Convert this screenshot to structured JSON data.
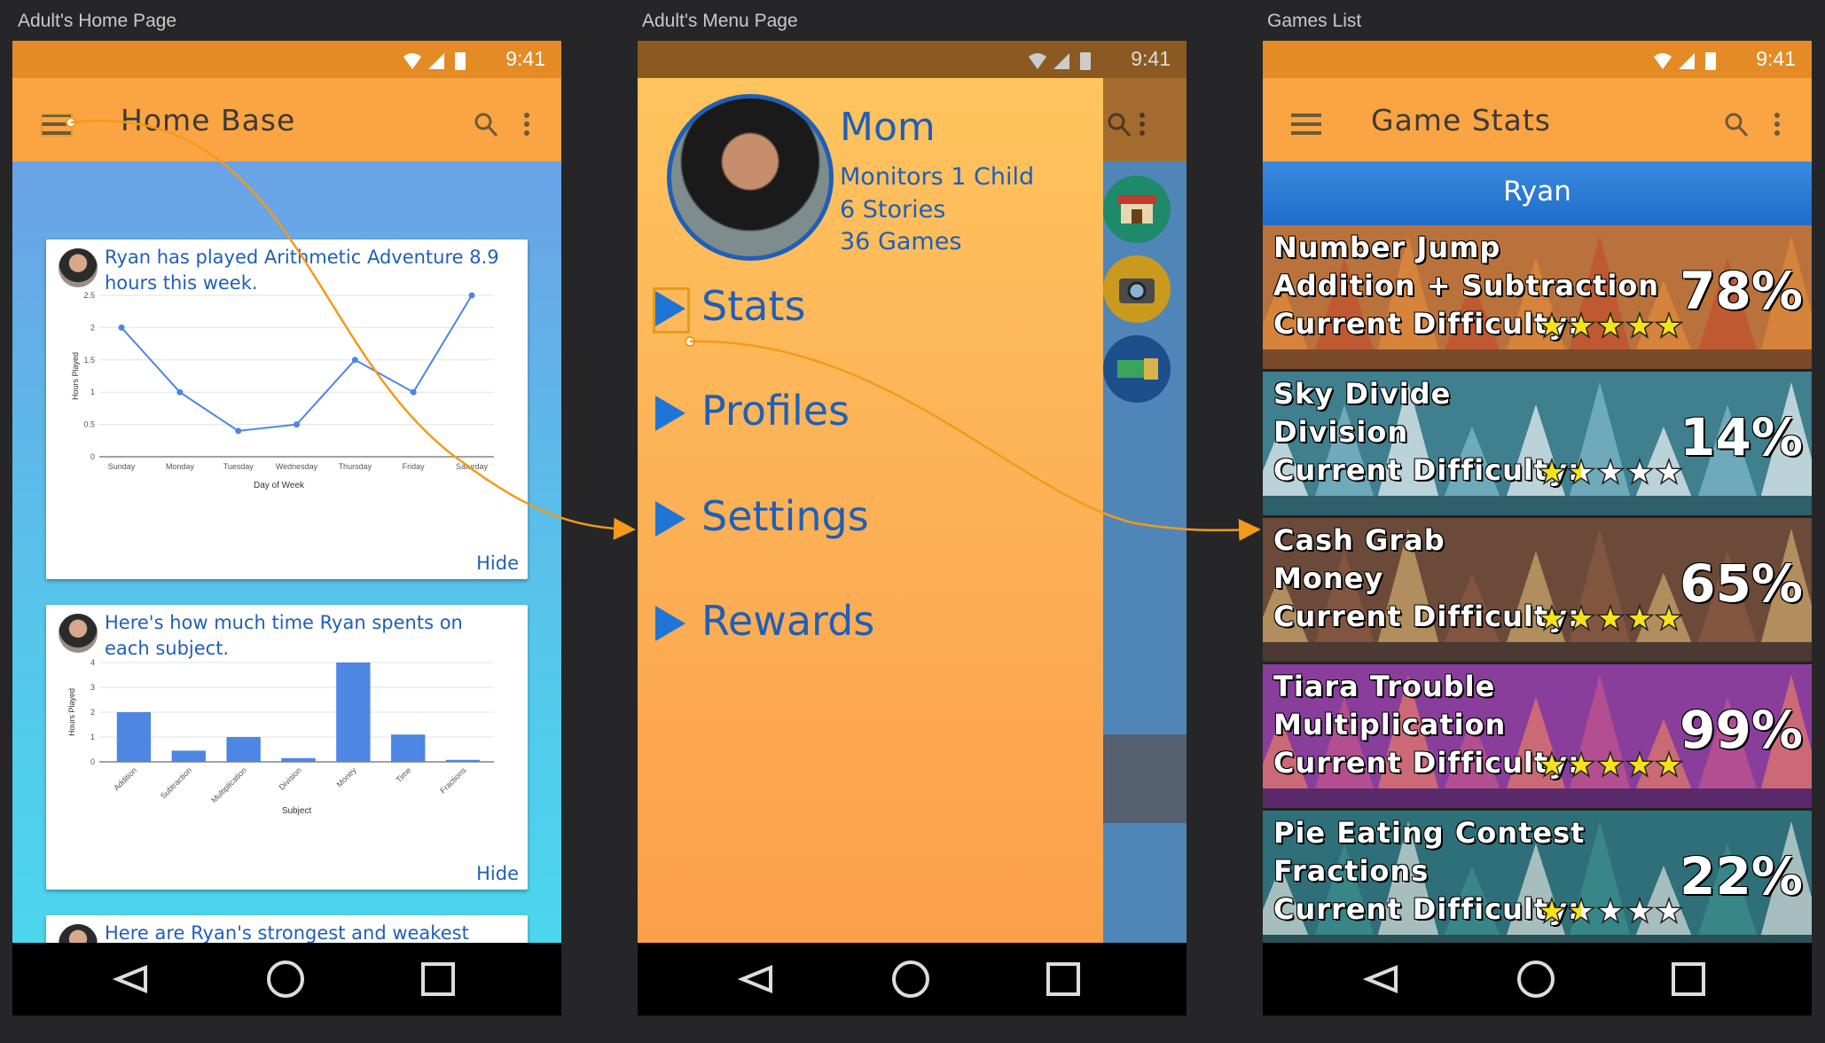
{
  "frames": [
    {
      "title": "Adult's Home Page"
    },
    {
      "title": "Adult's Menu Page"
    },
    {
      "title": "Games List"
    }
  ],
  "status": {
    "time": "9:41"
  },
  "home": {
    "appbar_title": "Home Base",
    "cards": [
      {
        "text": "Ryan has played Arithmetic Adventure 8.9 hours this week.",
        "hide": "Hide"
      },
      {
        "text": "Here's how much time Ryan spents on each subject.",
        "hide": "Hide"
      },
      {
        "text": "Here are Ryan's strongest and weakest subjects."
      }
    ]
  },
  "menu": {
    "name": "Mom",
    "lines": [
      "Monitors 1 Child",
      "6 Stories",
      "36 Games"
    ],
    "items": [
      "Stats",
      "Profiles",
      "Settings",
      "Rewards"
    ]
  },
  "games": {
    "appbar_title": "Game Stats",
    "child": "Ryan",
    "difficulty_label": "Current Difficulty:",
    "list": [
      {
        "name": "Number Jump",
        "subject": "Addition + Subtraction",
        "pct": "78%",
        "stars": 5,
        "theme": "autumn"
      },
      {
        "name": "Sky Divide",
        "subject": "Division",
        "pct": "14%",
        "stars": 1.5,
        "theme": "sky"
      },
      {
        "name": "Cash Grab",
        "subject": "Money",
        "pct": "65%",
        "stars": 5,
        "theme": "town"
      },
      {
        "name": "Tiara Trouble",
        "subject": "Multiplication",
        "pct": "99%",
        "stars": 5,
        "theme": "purple"
      },
      {
        "name": "Pie Eating Contest",
        "subject": "Fractions",
        "pct": "22%",
        "stars": 1.5,
        "theme": "teal"
      }
    ]
  },
  "chart_data": [
    {
      "type": "line",
      "categories": [
        "Sunday",
        "Monday",
        "Tuesday",
        "Wednesday",
        "Thursday",
        "Friday",
        "Saturday"
      ],
      "values": [
        2,
        1,
        0.4,
        0.5,
        1.5,
        1,
        2.5
      ],
      "xlabel": "Day of Week",
      "ylabel": "Hours Played",
      "yticks": [
        "0",
        "0.5",
        "1",
        "1.5",
        "2",
        "2.5"
      ],
      "ylim": [
        0,
        2.5
      ],
      "color": "#4d86e3"
    },
    {
      "type": "bar",
      "categories": [
        "Addition",
        "Subtraction",
        "Multiplication",
        "Division",
        "Money",
        "Time",
        "Fractions"
      ],
      "values": [
        2,
        0.45,
        1,
        0.15,
        4,
        1.1,
        0.08
      ],
      "xlabel": "Subject",
      "ylabel": "Hours Played",
      "yticks": [
        "0",
        "1",
        "2",
        "3",
        "4"
      ],
      "ylim": [
        0,
        4
      ],
      "color": "#4d86e3"
    }
  ],
  "colors": {
    "accent": "#fba443",
    "status": "#e48b25",
    "link": "#1f5fb8",
    "connector": "#f39a1a"
  }
}
